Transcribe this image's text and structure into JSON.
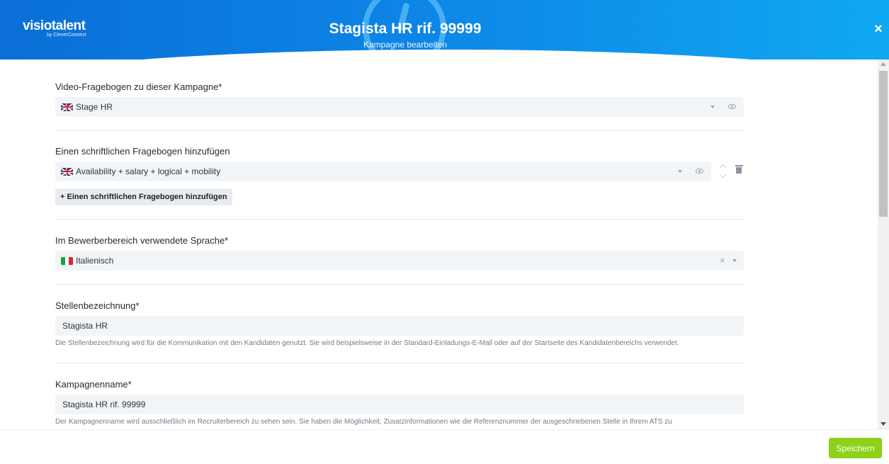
{
  "header": {
    "logo_main": "visiotalent",
    "logo_sub": "by CleverConnect",
    "title": "Stagista HR rif. 99999",
    "subtitle": "Kampagne bearbeiten",
    "close_label": "×"
  },
  "video_questionnaire": {
    "label": "Video-Fragebogen zu dieser Kampagne*",
    "value": "Stage HR",
    "flag": "uk-flag-icon"
  },
  "written_questionnaire": {
    "label": "Einen schriftlichen Fragebogen hinzufügen",
    "value": "Availability + salary + logical + mobility",
    "flag": "uk-flag-icon",
    "add_button": "+ Einen schriftlichen Fragebogen hinzufügen"
  },
  "candidate_language": {
    "label": "Im Bewerberbereich verwendete Sprache*",
    "value": "Italienisch",
    "flag": "italy-flag-icon",
    "clear_label": "×"
  },
  "job_title": {
    "label": "Stellenbezeichnung*",
    "value": "Stagista HR",
    "help": "Die Stellenbezeichnung wird für die Kommunikation mit den Kandidaten genutzt. Sie wird beispielsweise in der Standard-Einladungs-E-Mail oder auf der Startseite des Kandidatenbereichs verwendet."
  },
  "campaign_name": {
    "label": "Kampagnenname*",
    "value": "Stagista HR rif. 99999",
    "help": "Der Kampagnenname wird ausschließlich im Recruiterbereich zu sehen sein. Sie haben die Möglichkeit, Zusatzinformationen wie die Referenznummer der ausgeschriebenen Stelle in Ihrem ATS zu"
  },
  "footer": {
    "save_label": "Speichern"
  },
  "colors": {
    "header_start": "#0a6fd6",
    "header_end": "#10a8f0",
    "save_button": "#8dd11a",
    "field_background": "#f2f5f8"
  }
}
